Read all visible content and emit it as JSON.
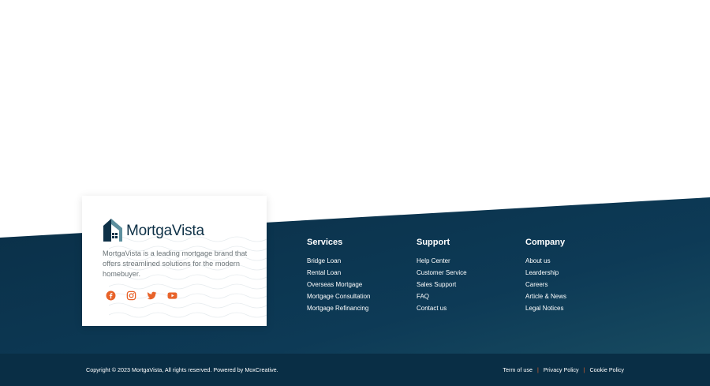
{
  "brand": {
    "name": "MortgaVista",
    "description": "MortgaVista is a leading mortgage brand that offers streamlined solutions for the modern homebuyer."
  },
  "socials": [
    {
      "icon": "facebook-icon"
    },
    {
      "icon": "instagram-icon"
    },
    {
      "icon": "twitter-icon"
    },
    {
      "icon": "youtube-icon"
    }
  ],
  "columns": {
    "services": {
      "title": "Services",
      "items": [
        "Bridge Loan",
        "Rental Loan",
        "Overseas Mortgage",
        "Mortgage Consultation",
        "Mortgage Refinancing"
      ]
    },
    "support": {
      "title": "Support",
      "items": [
        "Help Center",
        "Customer Service",
        "Sales Support",
        "FAQ",
        "Contact us"
      ]
    },
    "company": {
      "title": "Company",
      "items": [
        "About us",
        "Leardership",
        "Careers",
        "Article & News",
        "Legal Notices"
      ]
    }
  },
  "bottom": {
    "copyright": "Copyright © 2023 MortgaVista, All rights reserved. Powered by MoxCreative.",
    "links": [
      "Term of use",
      "Privacy Policy",
      "Cookie Policy"
    ],
    "separator": "|"
  },
  "colors": {
    "navy": "#0c3550",
    "accent": "#e8632a",
    "logo_teal": "#5d8f9e"
  }
}
